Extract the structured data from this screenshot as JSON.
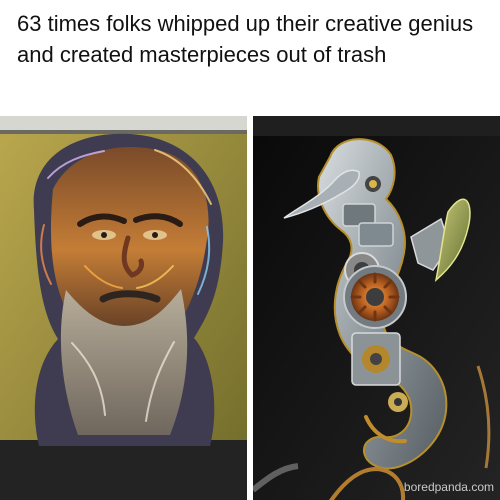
{
  "post": {
    "headline": "63 times folks whipped up their creative genius and created masterpieces out of trash"
  },
  "images": {
    "left": {
      "subject": "portrait-mosaic"
    },
    "right": {
      "subject": "seahorse-sculpture"
    }
  },
  "watermark": "boredpanda.com",
  "colors": {
    "background": "#ffffff",
    "text": "#111111",
    "portrait_accent": "#d8a23a",
    "sculpture_dark": "#141414",
    "sculpture_metal": "#9aa3a8",
    "sculpture_copper": "#c27b2c"
  }
}
